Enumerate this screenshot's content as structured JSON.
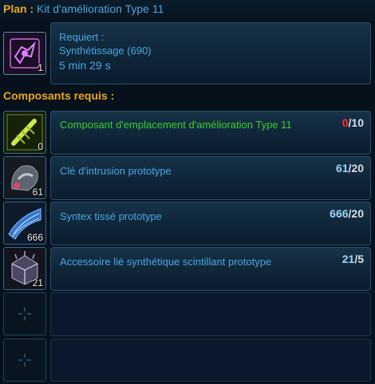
{
  "header": {
    "plan_label": "Plan :",
    "plan_name": "Kit d'amélioration Type 11"
  },
  "schematic": {
    "icon": "schematic-icon",
    "count": "1",
    "requires_label": "Requiert :",
    "skill": "Synthétissage (690)",
    "time": "5 min 29 s"
  },
  "components_title": "Composants requis :",
  "components": [
    {
      "icon": "modification-slot-component-icon",
      "count": "0",
      "name": "Composant d'emplacement d'amélioration Type 11",
      "have": "0",
      "need": "/10"
    },
    {
      "icon": "intrusion-key-icon",
      "count": "61",
      "name": "Clé d'intrusion prototype",
      "have": "61",
      "need": "/20"
    },
    {
      "icon": "woven-syntex-icon",
      "count": "666",
      "name": "Syntex tissé prototype",
      "have": "666",
      "need": "/20"
    },
    {
      "icon": "synthetic-accessory-icon",
      "count": "21",
      "name": "Accessoire lié synthétique scintillant prototype",
      "have": "21",
      "need": "/5"
    }
  ],
  "colors": {
    "accent_gold": "#e8a521",
    "text_blue": "#4aa6e0",
    "green": "#35d12b",
    "red": "#ff2a2a"
  }
}
